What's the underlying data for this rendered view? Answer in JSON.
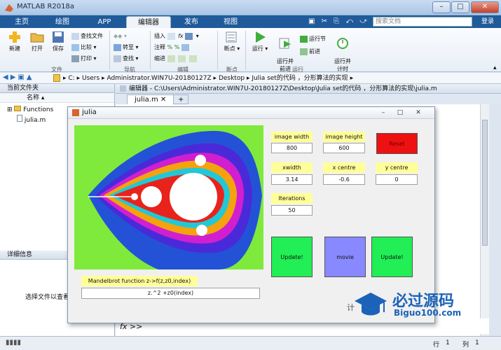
{
  "window": {
    "title": "MATLAB R2018a",
    "min": "–",
    "max": "□",
    "close": "✕"
  },
  "tabs": [
    {
      "label": "主页"
    },
    {
      "label": "绘图"
    },
    {
      "label": "APP"
    },
    {
      "label": "编辑器"
    },
    {
      "label": "发布"
    },
    {
      "label": "视图"
    }
  ],
  "search": {
    "placeholder": "搜索文档"
  },
  "login": "登录",
  "ribbon": {
    "file": {
      "new": "新建",
      "open": "打开",
      "save": "保存",
      "find_files": "查找文件",
      "compare": "比较",
      "print": "打印",
      "section": "文件"
    },
    "nav": {
      "goto": "转至",
      "find": "查找",
      "section": "导航"
    },
    "edit": {
      "insert": "插入",
      "comment": "注释",
      "indent": "缩进",
      "section": "编辑"
    },
    "breakpoint": {
      "label": "断点",
      "section": "断点"
    },
    "run": {
      "run": "运行",
      "run_advance": "运行并\n前进",
      "run_section": "运行节",
      "advance": "前进",
      "run_time": "运行并\n计时",
      "section": "运行"
    }
  },
  "address": {
    "path": [
      "C:",
      "Users",
      "Administrator.WIN7U-20180127Z",
      "Desktop",
      "Julia set的代码 ，分形算法的实现"
    ]
  },
  "left_panel": {
    "title": "当前文件夹",
    "col_name": "名称",
    "items": [
      {
        "name": "Functions"
      },
      {
        "name": "julia.m"
      }
    ],
    "details_title": "详细信息",
    "details_text": "选择文件以查看"
  },
  "editor": {
    "header": "编辑器 - C:\\Users\\Administrator.WIN7U-20180127Z\\Desktop\\Julia set的代码 ，分形算法的实现\\julia.m",
    "tab": "julia.m",
    "add_tab": "+",
    "cmd_prompt": "fx >>"
  },
  "status": {
    "row_label": "行",
    "row": "1",
    "col_label": "列",
    "col": "1"
  },
  "julia": {
    "title": "julia",
    "fields": {
      "image_width": {
        "label": "image width",
        "value": "800"
      },
      "image_height": {
        "label": "image height",
        "value": "600"
      },
      "xwidth": {
        "label": "xwidth",
        "value": "3.14"
      },
      "x_centre": {
        "label": "x centre",
        "value": "-0.6"
      },
      "y_centre": {
        "label": "y centre",
        "value": "0"
      },
      "iterations": {
        "label": "Iterations",
        "value": "50"
      }
    },
    "reset": "Reset",
    "buttons": {
      "update_left": "Update!",
      "movie": "movie",
      "update_right": "Update!"
    },
    "function_label": "Mandelbrot function z->f(z,z0,index)",
    "function_value": "z.^2 +z0(index)",
    "colors": {
      "reset": "#ee1111",
      "update": "#22ee55",
      "movie": "#8888ff",
      "labels": "#ffff99"
    }
  },
  "watermark": {
    "title": "必过源码",
    "url": "Biguo100.com",
    "caption": "计"
  }
}
